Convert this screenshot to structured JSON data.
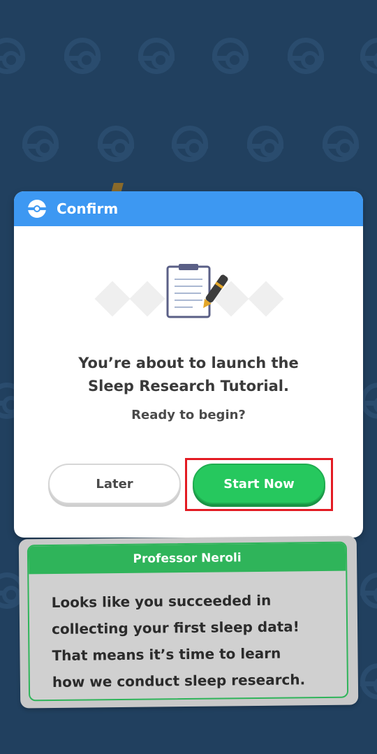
{
  "dialog": {
    "title": "Confirm",
    "message_line1": "You’re about to launch the",
    "message_line2": "Sleep Research Tutorial.",
    "sub": "Ready to begin?",
    "later_label": "Later",
    "start_label": "Start Now"
  },
  "speech": {
    "speaker": "Professor Neroli",
    "line1": "Looks like you succeeded in",
    "line2": "collecting your first sleep data!",
    "line3": "That means it’s time to learn",
    "line4": "how we conduct sleep research."
  },
  "colors": {
    "background": "#21405f",
    "header": "#3d98f2",
    "start_button": "#26c85e",
    "speaker_bar": "#2fb45a",
    "highlight": "#e31b23"
  },
  "icons": [
    "pokeball-icon",
    "clipboard-icon",
    "pen-icon"
  ]
}
